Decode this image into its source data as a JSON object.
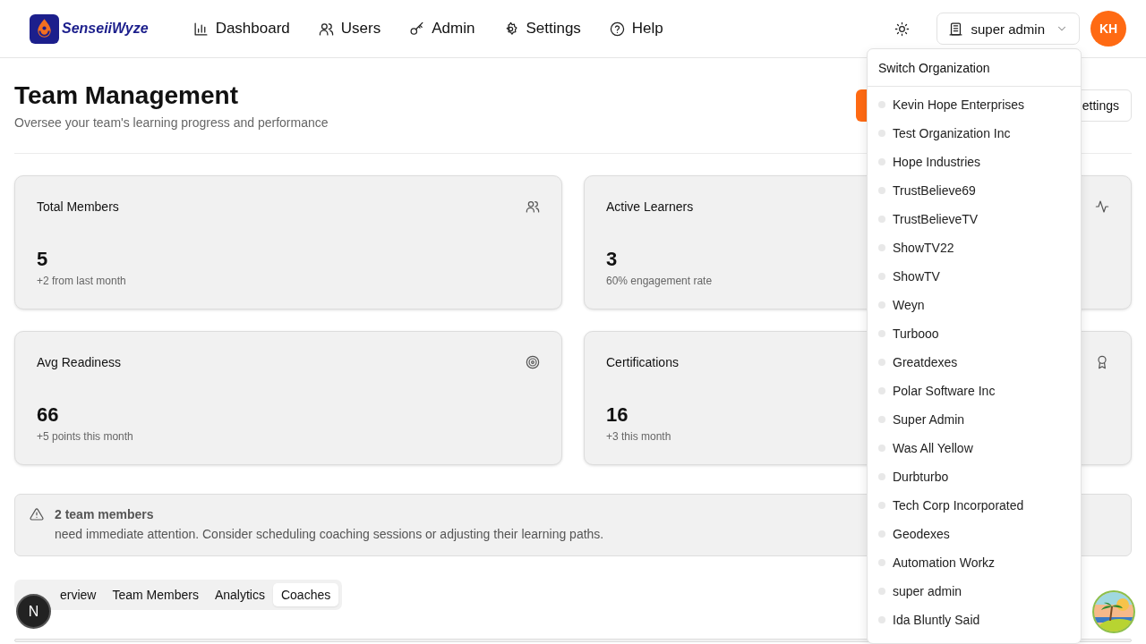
{
  "brand": {
    "name": "SenseiiWyze"
  },
  "nav": [
    {
      "label": "Dashboard"
    },
    {
      "label": "Users"
    },
    {
      "label": "Admin"
    },
    {
      "label": "Settings"
    },
    {
      "label": "Help"
    }
  ],
  "org_switcher": {
    "value": "super admin"
  },
  "avatar": {
    "initials": "KH"
  },
  "page": {
    "title": "Team Management",
    "subtitle": "Oversee your team's learning progress and performance",
    "buttons": [
      {
        "kind": "primary"
      },
      {
        "kind": "secondary",
        "label": "ettings"
      }
    ]
  },
  "stats": [
    {
      "label": "Total Members",
      "value": "5",
      "note": "+2 from last month"
    },
    {
      "label": "Active Learners",
      "value": "3",
      "note": "60% engagement rate"
    },
    {
      "label": "Avg Readiness",
      "value": "66",
      "note": "+5 points this month"
    },
    {
      "label": "Certifications",
      "value": "16",
      "note": "+3 this month"
    }
  ],
  "alert": {
    "title": "2 team members",
    "message": "need immediate attention. Consider scheduling coaching sessions or adjusting their learning paths."
  },
  "tabs": [
    {
      "label": "erview",
      "selected": false
    },
    {
      "label": "Team Members",
      "selected": false
    },
    {
      "label": "Analytics",
      "selected": false
    },
    {
      "label": "Coaches",
      "selected": true
    }
  ],
  "dropdown": {
    "title": "Switch Organization",
    "items": [
      "Kevin Hope Enterprises",
      "Test Organization Inc",
      "Hope Industries",
      "TrustBelieve69",
      "TrustBelieveTV",
      "ShowTV22",
      "ShowTV",
      "Weyn",
      "Turbooo",
      "Greatdexes",
      "Polar Software Inc",
      "Super Admin",
      "Was All Yellow",
      "Durbturbo",
      "Tech Corp Incorporated",
      "Geodexes",
      "Automation Workz",
      "super admin",
      "Ida Bluntly Said"
    ]
  },
  "dev_badge": {
    "letter": "N"
  }
}
